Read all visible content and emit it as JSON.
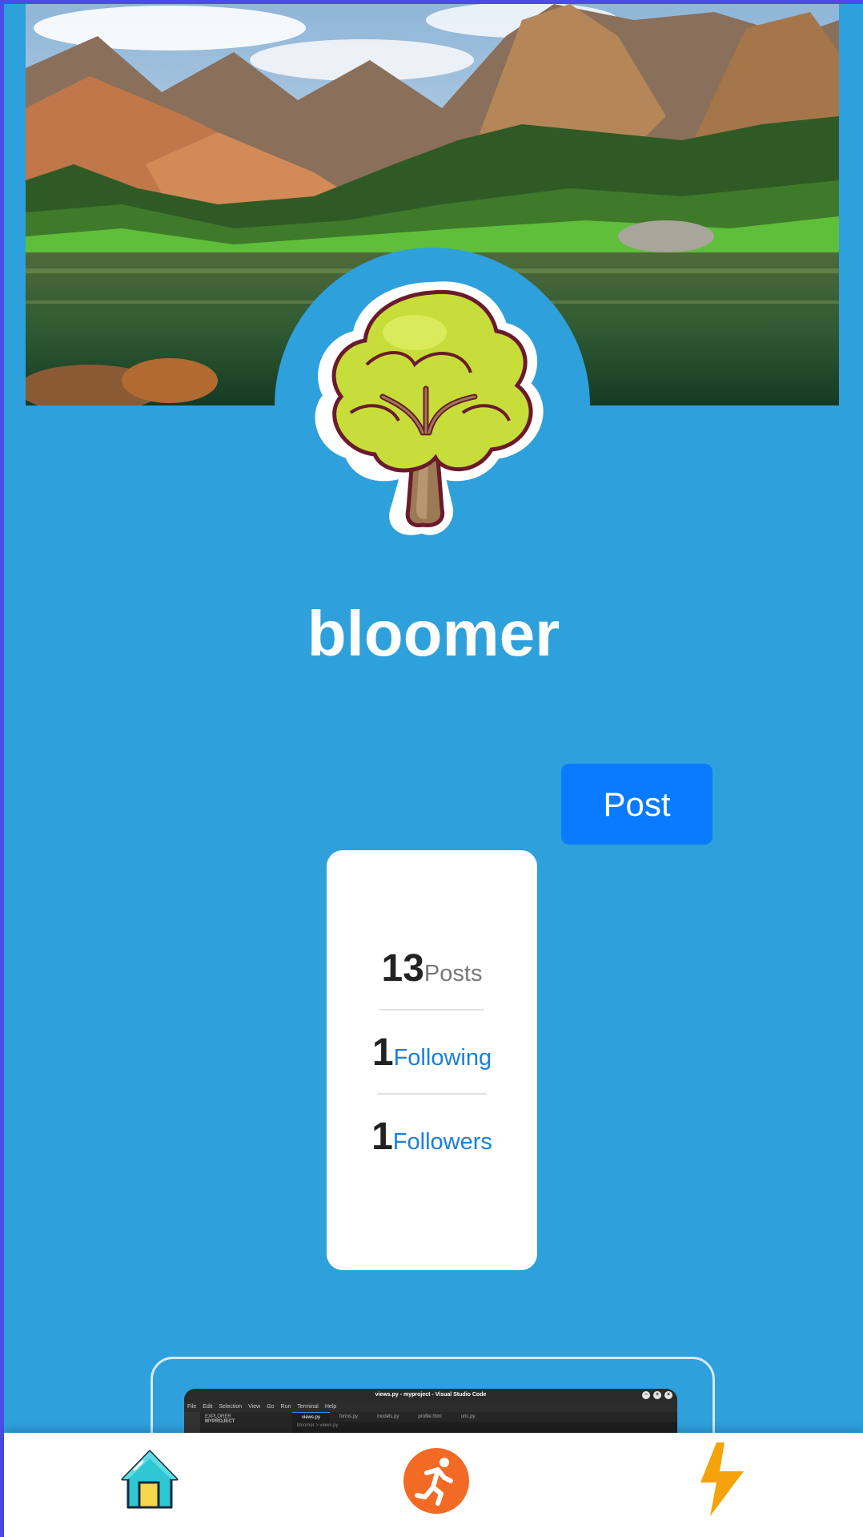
{
  "profile": {
    "username": "bloomer"
  },
  "actions": {
    "post_label": "Post"
  },
  "stats": {
    "posts_count": "13",
    "posts_label": "Posts",
    "following_count": "1",
    "following_label": "Following",
    "followers_count": "1",
    "followers_label": "Followers"
  },
  "post_preview": {
    "window_title": "views.py - myproject - Visual Studio Code",
    "menu": [
      "File",
      "Edit",
      "Selection",
      "View",
      "Go",
      "Run",
      "Terminal",
      "Help"
    ],
    "explorer_label": "EXPLORER",
    "project_label": "MYPROJECT",
    "tabs": [
      "views.py",
      "forms.py",
      "models.py",
      "profile.html",
      "urls.py"
    ],
    "breadcrumb": "bloomer > views.py"
  },
  "nav": {
    "items": [
      {
        "icon": "home-icon"
      },
      {
        "icon": "running-person-icon"
      },
      {
        "icon": "lightning-bolt-icon"
      }
    ]
  },
  "colors": {
    "page_bg": "#2ea0dc",
    "accent_button": "#0a7bff",
    "outer_border": "#4b4ce8",
    "link_blue": "#1a7fdc"
  }
}
